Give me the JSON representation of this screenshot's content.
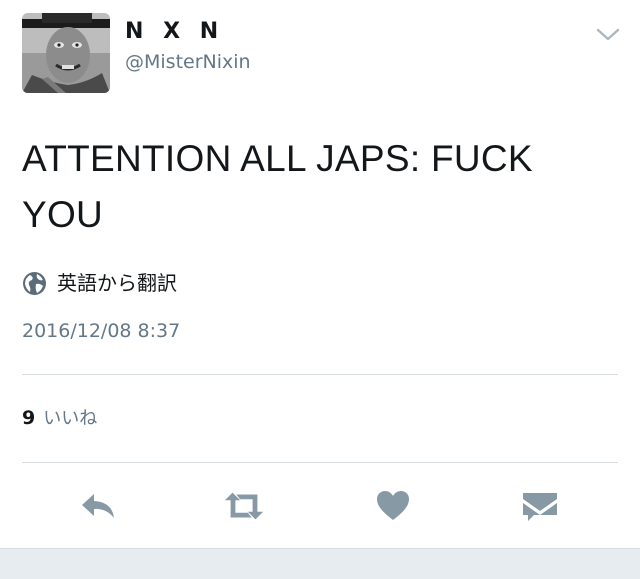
{
  "profile": {
    "display_name": "N X N",
    "handle": "@MisterNixin"
  },
  "tweet": {
    "text": "ATTENTION ALL JAPS:  FUCK YOU",
    "translate_label": "英語から翻訳",
    "timestamp": "2016/12/08 8:37"
  },
  "stats": {
    "likes_count": "9",
    "likes_label": "いいね"
  },
  "icons": {
    "caret": "chevron-down-icon",
    "translate": "globe-icon",
    "reply": "reply-icon",
    "retweet": "retweet-icon",
    "like": "heart-icon",
    "dm": "envelope-icon"
  },
  "colors": {
    "text": "#14171a",
    "secondary": "#657786",
    "icon": "#8899a6",
    "divider": "#d8dde2"
  }
}
